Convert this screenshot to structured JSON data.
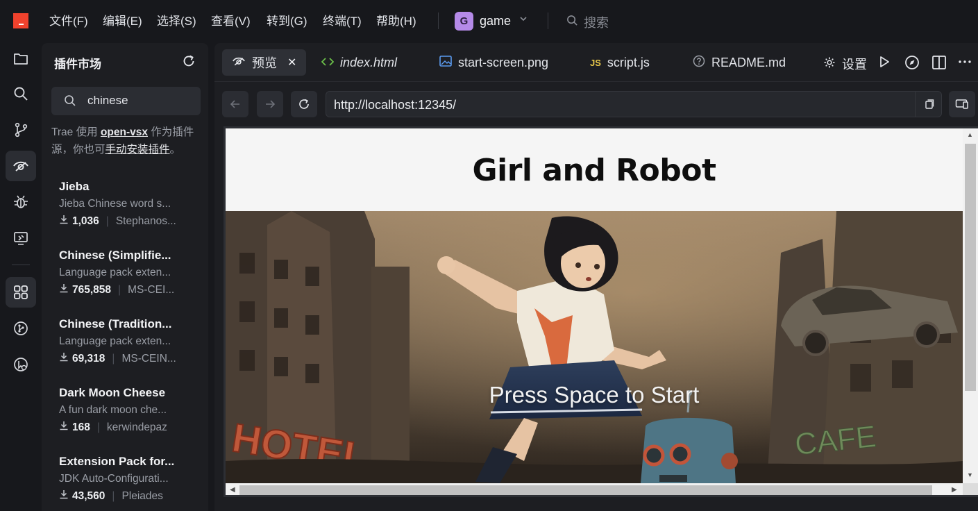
{
  "menu": [
    "文件(F)",
    "编辑(E)",
    "选择(S)",
    "查看(V)",
    "转到(G)",
    "终端(T)",
    "帮助(H)"
  ],
  "project": {
    "badge": "G",
    "name": "game"
  },
  "title_search": "搜索",
  "activity_icons": [
    "explorer-icon",
    "search-icon",
    "source-control-icon",
    "preview-icon",
    "debug-icon",
    "remote-icon",
    "extensions-icon",
    "git-graph-icon",
    "cursor-agent-icon"
  ],
  "sidebar": {
    "title": "插件市场",
    "search_value": "chinese",
    "note_prefix": "Trae 使用 ",
    "note_link1": "open-vsx",
    "note_mid": " 作为插件源，你也可",
    "note_link2": "手动安装插件",
    "note_suffix": "。",
    "extensions": [
      {
        "name": "Jieba",
        "desc": "Jieba Chinese word s...",
        "downloads": "1,036",
        "publisher": "Stephanos..."
      },
      {
        "name": "Chinese (Simplifie...",
        "desc": "Language pack exten...",
        "downloads": "765,858",
        "publisher": "MS-CEI..."
      },
      {
        "name": "Chinese (Tradition...",
        "desc": "Language pack exten...",
        "downloads": "69,318",
        "publisher": "MS-CEIN..."
      },
      {
        "name": "Dark Moon Cheese",
        "desc": "A fun dark moon che...",
        "downloads": "168",
        "publisher": "kerwindepaz"
      },
      {
        "name": "Extension Pack for...",
        "desc": "JDK Auto-Configurati...",
        "downloads": "43,560",
        "publisher": "Pleiades"
      }
    ]
  },
  "tabs": [
    {
      "label": "预览",
      "active": true
    },
    {
      "label": "index.html"
    },
    {
      "label": "start-screen.png"
    },
    {
      "label": "script.js"
    },
    {
      "label": "README.md"
    }
  ],
  "toolbar": {
    "settings_label": "设置"
  },
  "browser": {
    "url": "http://localhost:12345/"
  },
  "page": {
    "title": "Girl and Robot",
    "start_prompt": "Press Space to Start",
    "sign_hotel": "HOTEL",
    "sign_cafe": "CAFE"
  },
  "colors": {
    "accent_logo": "#f0422d",
    "project_badge": "#b58ae8",
    "bg": "#17181c",
    "panel": "#1d1e22"
  }
}
